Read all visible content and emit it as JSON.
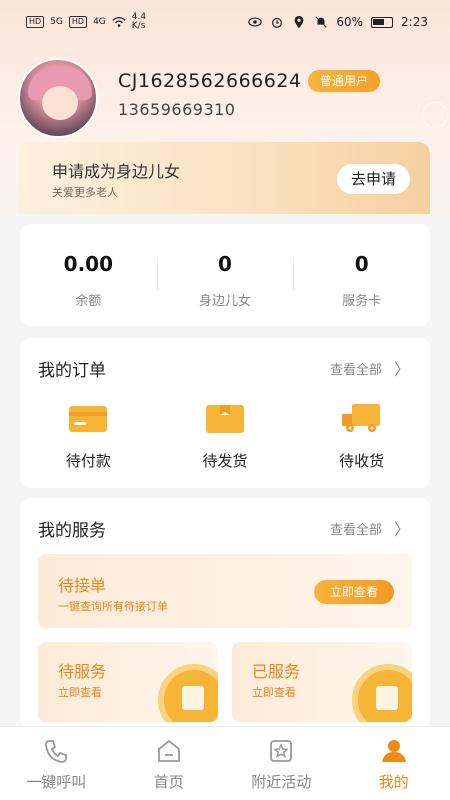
{
  "status_bar": {
    "left_tags": [
      "HD",
      "HD"
    ],
    "signal": "5G",
    "signal2": "4G",
    "speed": "4.4",
    "speed_unit": "K/s",
    "battery": "60%",
    "time": "2:23"
  },
  "profile": {
    "user_id": "CJ1628562666624",
    "badge": "普通用户",
    "phone": "13659669310"
  },
  "apply": {
    "title": "申请成为身边儿女",
    "subtitle": "关爱更多老人",
    "button": "去申请"
  },
  "stats": [
    {
      "value": "0.00",
      "label": "余额"
    },
    {
      "value": "0",
      "label": "身边儿女"
    },
    {
      "value": "0",
      "label": "服务卡"
    }
  ],
  "orders": {
    "title": "我的订单",
    "more": "查看全部",
    "items": [
      {
        "label": "待付款",
        "icon": "card-icon"
      },
      {
        "label": "待发货",
        "icon": "box-icon"
      },
      {
        "label": "待收货",
        "icon": "truck-icon"
      }
    ]
  },
  "services": {
    "title": "我的服务",
    "more": "查看全部",
    "main": {
      "title": "待接单",
      "subtitle": "一键查询所有待接订单",
      "button": "立即查看"
    },
    "left": {
      "title": "待服务",
      "subtitle": "立即查看"
    },
    "right": {
      "title": "已服务",
      "subtitle": "立即查看"
    }
  },
  "tabs": [
    {
      "label": "一键呼叫",
      "icon": "phone-icon"
    },
    {
      "label": "首页",
      "icon": "home-icon"
    },
    {
      "label": "附近活动",
      "icon": "star-icon"
    },
    {
      "label": "我的",
      "icon": "user-icon"
    }
  ],
  "colors": {
    "accent": "#f08a12",
    "badge": "#f9b33c"
  }
}
